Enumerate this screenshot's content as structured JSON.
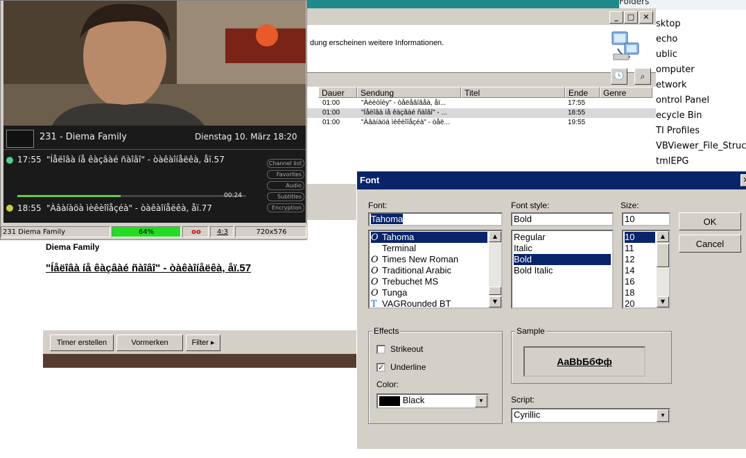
{
  "desktop": {
    "folders_label": "Folders",
    "items": [
      "sktop",
      "echo",
      "ublic",
      "omputer",
      "etwork",
      "ontrol Panel",
      "ecycle Bin",
      "TI Profiles",
      "VBViewer_File_Struc",
      "tmlEPG"
    ]
  },
  "epg": {
    "info_text": "dung erscheinen weitere Informationen.",
    "columns": [
      "Dauer",
      "Sendung",
      "Titel",
      "Ende",
      "Genre"
    ],
    "rows": [
      {
        "dauer": "01:00",
        "sendung": "\"Àèèòîèy\" - òåëåâîâåà, åï...",
        "titel": "",
        "ende": "17:55"
      },
      {
        "dauer": "01:00",
        "sendung": "\"Íåëîâà íå êàçâàé ñàîâî\" - ...",
        "titel": "",
        "ende": "18:55"
      },
      {
        "dauer": "01:00",
        "sendung": "\"Àâàíàöà ìèêèîîåçéà\" - òåë...",
        "titel": "",
        "ende": "19:55"
      }
    ],
    "detail_channel": "Diema Family",
    "detail_title": "\"Íåëîâà íå êàçâàé ñàîâî\" - òàêàîíåëêà, åï.57",
    "buttons": {
      "timer": "Timer erstellen",
      "vormerken": "Vormerken",
      "filter": "Filter"
    }
  },
  "video": {
    "channel": "231 - Diema Family",
    "datetime": "Dienstag 10. März 18:20",
    "now_time": "17:55",
    "now_title": "\"Íåëîâà íå êàçâàé ñàîâî\" - òàêàîíåëêà, åï.57",
    "progress_time": "00:24",
    "progress": 0.45,
    "next_time": "18:55",
    "next_title": "\"Àâàíàöà ìèêèîîåçéà\" - òàêàîíåëêà, åï.77",
    "side_labels": [
      "Channel list",
      "Favorites",
      "Audio",
      "Subtitles",
      "Encryption"
    ],
    "status": {
      "channel": "231 Diema Family",
      "signal": "64%",
      "aspect": "4:3",
      "resolution": "720x576"
    }
  },
  "font_dialog": {
    "title": "Font",
    "font_label": "Font:",
    "font_value": "Tahoma",
    "fonts": [
      "Tahoma",
      "Terminal",
      "Times New Roman",
      "Traditional Arabic",
      "Trebuchet MS",
      "Tunga",
      "VAGRounded BT"
    ],
    "style_label": "Font style:",
    "style_value": "Bold",
    "styles": [
      "Regular",
      "Italic",
      "Bold",
      "Bold Italic"
    ],
    "size_label": "Size:",
    "size_value": "10",
    "sizes": [
      "10",
      "11",
      "12",
      "14",
      "16",
      "18",
      "20"
    ],
    "ok": "OK",
    "cancel": "Cancel",
    "effects_label": "Effects",
    "strikeout": "Strikeout",
    "underline": "Underline",
    "color_label": "Color:",
    "color_value": "Black",
    "sample_label": "Sample",
    "sample_text": "AaBbБбФф",
    "script_label": "Script:",
    "script_value": "Cyrillic",
    "colors": {
      "title_bar": "#0a246a",
      "selection": "#0a246a",
      "signal": "#22dd22"
    }
  }
}
